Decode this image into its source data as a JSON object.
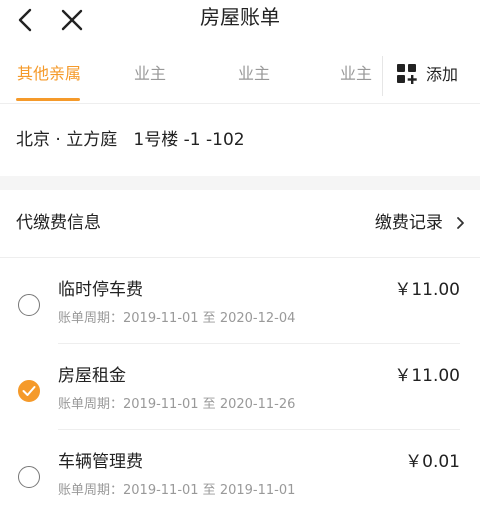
{
  "header": {
    "title": "房屋账单",
    "back_icon": "back-arrow-icon",
    "close_icon": "close-icon"
  },
  "tabs": [
    {
      "label": "其他亲属",
      "active": true
    },
    {
      "label": "业主",
      "active": false
    },
    {
      "label": "业主",
      "active": false
    },
    {
      "label": "业主",
      "active": false
    }
  ],
  "add_button": {
    "label": "添加",
    "icon": "grid-add-icon"
  },
  "address": "北京 · 立方庭   1号楼 -1 -102",
  "section": {
    "title": "代缴费信息",
    "records_label": "缴费记录"
  },
  "colors": {
    "accent": "#f59a2a",
    "text": "#222222",
    "muted": "#999999"
  },
  "bills": [
    {
      "name": "临时停车费",
      "amount": "￥11.00",
      "period": "账单周期：2019-11-01 至 2020-12-04",
      "checked": false
    },
    {
      "name": "房屋租金",
      "amount": "￥11.00",
      "period": "账单周期：2019-11-01 至 2020-11-26",
      "checked": true
    },
    {
      "name": "车辆管理费",
      "amount": "￥0.01",
      "period": "账单周期：2019-11-01 至 2019-11-01",
      "checked": false
    }
  ]
}
